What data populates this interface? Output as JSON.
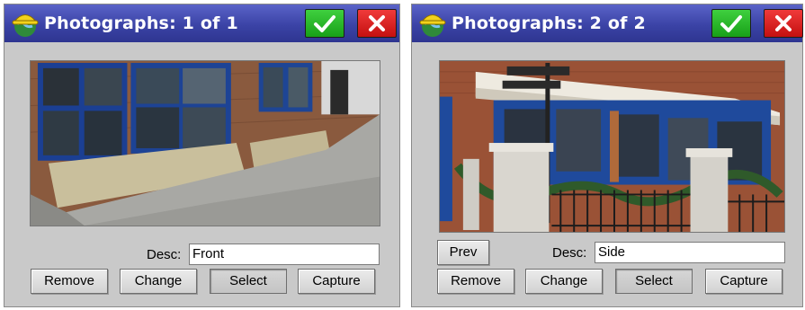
{
  "dialogs": [
    {
      "title": "Photographs: 1 of 1",
      "desc_label": "Desc:",
      "desc_value": "Front",
      "buttons": {
        "remove": "Remove",
        "change": "Change",
        "select": "Select",
        "capture": "Capture"
      },
      "photo_subject": "building-front-sidewalk"
    },
    {
      "title": "Photographs: 2 of 2",
      "desc_label": "Desc:",
      "desc_value": "Side",
      "buttons": {
        "prev": "Prev",
        "remove": "Remove",
        "change": "Change",
        "select": "Select",
        "capture": "Capture"
      },
      "photo_subject": "building-side-fence"
    }
  ],
  "icons": {
    "app": "hardhat-globe-icon",
    "ok": "checkmark-icon",
    "close": "close-icon"
  },
  "colors": {
    "titlebar": "#3b43a6",
    "ok": "#22b022",
    "close": "#d81e1e",
    "dialog_bg": "#c9c9c9"
  }
}
